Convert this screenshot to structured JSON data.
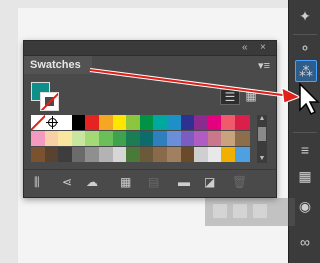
{
  "panel": {
    "title": "Swatches",
    "top_controls": [
      "«",
      "×"
    ],
    "menu_icon": "panel-menu-icon"
  },
  "colors": {
    "fill": "#0f8f8a",
    "stroke_slash": "#e0201b",
    "annotation_arrow": "#e0201b",
    "toolbar_highlight": "#4aa3ff"
  },
  "view_buttons": [
    "list-view-icon",
    "grid-view-icon"
  ],
  "swatch_rows": [
    [
      "none",
      "registration",
      "#ffffff",
      "#000000",
      "#e52421",
      "#f5a623",
      "#ffe600",
      "#8cc63f",
      "#009245",
      "#00a99d",
      "#1e90c8",
      "#2e3192",
      "#8b2a8f",
      "#e4007f",
      "#ef5b6b",
      "#d91f4a"
    ],
    [
      "#f49ac1",
      "#f7d0a5",
      "#f9e79f",
      "#c8e6a0",
      "#a3d977",
      "#6bbf59",
      "#3fa34d",
      "#1c7c54",
      "#0e6b6b",
      "#2f7fbf",
      "#6a8fd8",
      "#7a5cc2",
      "#b05cc2",
      "#c8788a",
      "#c9a27e",
      "#8d6e4a"
    ],
    [
      "#7a5230",
      "#5a4230",
      "#3d3d3d",
      "#6b6b6b",
      "#8f8f8f",
      "#b3b3b3",
      "#d6d6d6",
      "#4a7a3a",
      "#6a5a3a",
      "#8a6a4a",
      "#a08060",
      "#6b4a2a",
      "#cfcfcf",
      "#e8e8e8",
      "#f0b000",
      "#4fa0e0"
    ]
  ],
  "bottom_icons": [
    "library-icon",
    "share-icon",
    "cloud-icon",
    "swatch-kind-icon",
    "options-icon",
    "folder-icon",
    "new-swatch-icon",
    "trash-icon"
  ],
  "toolbar_icons": [
    "puppet-icon",
    "pen-cursor-icon",
    "fill-icon",
    "gradient-icon",
    "appearance-icon",
    "layers-icon",
    "cc-library-icon"
  ]
}
